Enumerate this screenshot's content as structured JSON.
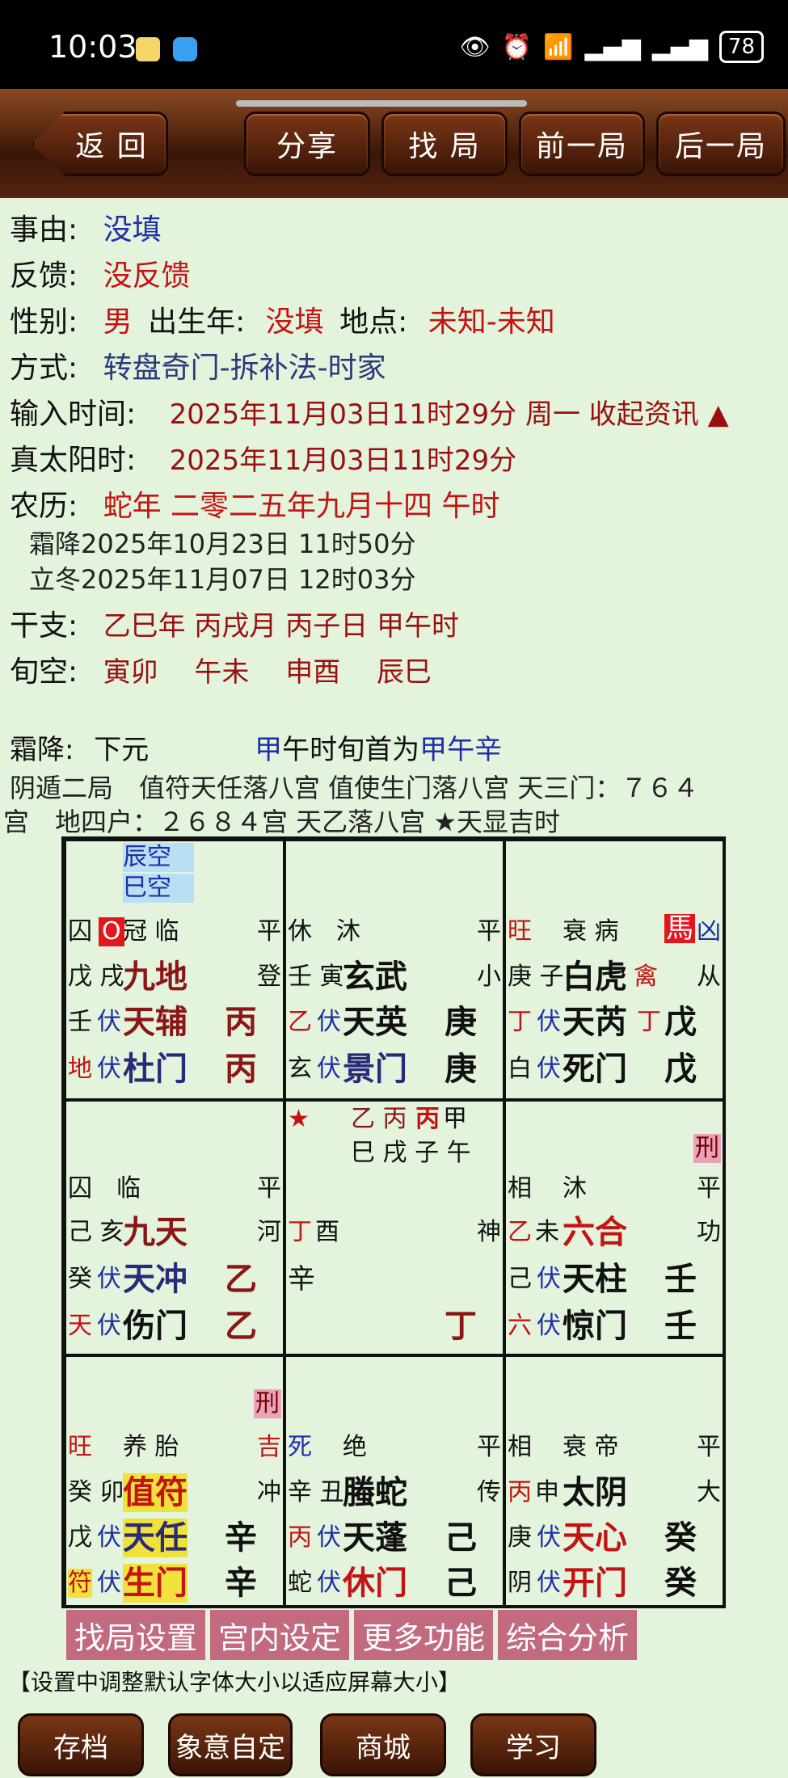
{
  "status_bar": {
    "time": "10:03",
    "battery": "78"
  },
  "toolbar": {
    "back": "返 回",
    "share": "分享",
    "find": "找 局",
    "prev": "前一局",
    "next": "后一局"
  },
  "info": {
    "reason_label": "事由:",
    "reason_value": "没填",
    "feedback_label": "反馈:",
    "feedback_value": "没反馈",
    "gender_label": "性别:",
    "gender_value": "男",
    "birth_label": "出生年:",
    "birth_value": "没填",
    "place_label": "地点:",
    "place_value": "未知-未知",
    "method_label": "方式:",
    "method_value": "转盘奇门-拆补法-时家",
    "input_time_label": "输入时间:",
    "input_time_value": "2025年11月03日11时29分 周一 收起资讯 ▲",
    "solar_time_label": "真太阳时:",
    "solar_time_value": "2025年11月03日11时29分",
    "lunar_label": "农历:",
    "lunar_value": "蛇年 二零二五年九月十四 午时",
    "term1": "霜降2025年10月23日 11时50分",
    "term2": "立冬2025年11月07日 12时03分",
    "ganzhi_label": "干支:",
    "ganzhi_value": "乙巳年 丙戌月 丙子日 甲午时",
    "xunkong_label": "旬空:",
    "xunkong_value": "寅卯　 午未　 申酉　 辰巳",
    "jieqi": "霜降:",
    "yuan": "下元",
    "xunshou_a": "甲",
    "xunshou_b": "午时旬首为",
    "xunshou_c": "甲午辛",
    "ju_line": "阴遁二局　值符天任落八宫 值使生门落八宫 天三门：７６４",
    "ju_line2": "宫　地四户：２６８４宫 天乙落八宫 ★天显吉时"
  },
  "board": {
    "c1": {
      "kong1": "辰空",
      "kong2": "巳空",
      "state1": "囚",
      "o": "O",
      "state2": "冠 临",
      "right1": "平",
      "gz": "戊 戌",
      "god": "九地",
      "right2": "登",
      "tian_stem": "壬",
      "fu": "伏",
      "star": "天辅",
      "stem_r": "丙",
      "di": "地",
      "fu2": "伏",
      "door": "杜门",
      "stem_r2": "丙"
    },
    "c2": {
      "state": "休　沐",
      "right1": "平",
      "gz": "壬 寅",
      "god": "玄武",
      "right2": "小",
      "tian_stem": "乙",
      "fu": "伏",
      "star": "天英",
      "stem_r": "庚",
      "di": "玄",
      "fu2": "伏",
      "door": "景门",
      "stem_r2": "庚"
    },
    "c3": {
      "state1": "旺",
      "state2": "衰 病",
      "horse": "馬",
      "xiong": "凶",
      "gz": "庚 子",
      "god": "白虎",
      "qin": "禽",
      "right2": "从",
      "tian_stem": "丁",
      "fu": "伏",
      "star": "天芮",
      "ding": "丁",
      "stem_r": "戊",
      "di": "白",
      "fu2": "伏",
      "door": "死门",
      "stem_r2": "戊"
    },
    "c4": {
      "state": "囚　临",
      "right1": "平",
      "gz": "己 亥",
      "god": "九天",
      "right2": "河",
      "tian_stem": "癸",
      "fu": "伏",
      "star": "天冲",
      "stem_r": "乙",
      "di": "天",
      "fu2": "伏",
      "door": "伤门",
      "stem_r2": "乙"
    },
    "c5": {
      "star_mark": "★",
      "top1": "乙 丙",
      "top2": "丙",
      "top3": "甲",
      "mid": "巳 戌 子 午",
      "ding": "丁",
      "you": "酉",
      "shen": "神",
      "xin": "辛",
      "ding2": "丁"
    },
    "c6": {
      "xing": "刑",
      "state1": "相",
      "state2": "沐",
      "right1": "平",
      "gz_a": "乙",
      "gz_b": "未",
      "god": "六合",
      "right2": "功",
      "tian_stem": "己",
      "fu": "伏",
      "star": "天柱",
      "stem_r": "壬",
      "di": "六",
      "fu2": "伏",
      "door": "惊门",
      "stem_r2": "壬"
    },
    "c7": {
      "xing": "刑",
      "state1": "旺",
      "state2": "养 胎",
      "ji": "吉",
      "gz": "癸 卯",
      "god": "值符",
      "right2": "冲",
      "tian_stem": "戊",
      "fu": "伏",
      "star": "天任",
      "stem_r": "辛",
      "di": "符",
      "fu2": "伏",
      "door": "生门",
      "stem_r2": "辛"
    },
    "c8": {
      "state1": "死",
      "state2": "绝",
      "right1": "平",
      "gz": "辛 丑",
      "god": "螣蛇",
      "right2": "传",
      "tian_stem": "丙",
      "fu": "伏",
      "star": "天蓬",
      "stem_r": "己",
      "di": "蛇",
      "fu2": "伏",
      "door": "休门",
      "stem_r2": "己"
    },
    "c9": {
      "state1": "相",
      "state2": "衰 帝",
      "right1": "平",
      "gz_a": "丙",
      "gz_b": "申",
      "god": "太阴",
      "right2": "大",
      "tian_stem": "庚",
      "fu": "伏",
      "star": "天心",
      "stem_r": "癸",
      "di": "阴",
      "fu2": "伏",
      "door": "开门",
      "stem_r2": "癸"
    }
  },
  "tabs": [
    "找局设置",
    "宫内设定",
    "更多功能",
    "综合分析"
  ],
  "hint": "【设置中调整默认字体大小以适应屏幕大小】",
  "bottom_buttons": [
    "存档",
    "象意自定",
    "商城",
    "学习"
  ]
}
